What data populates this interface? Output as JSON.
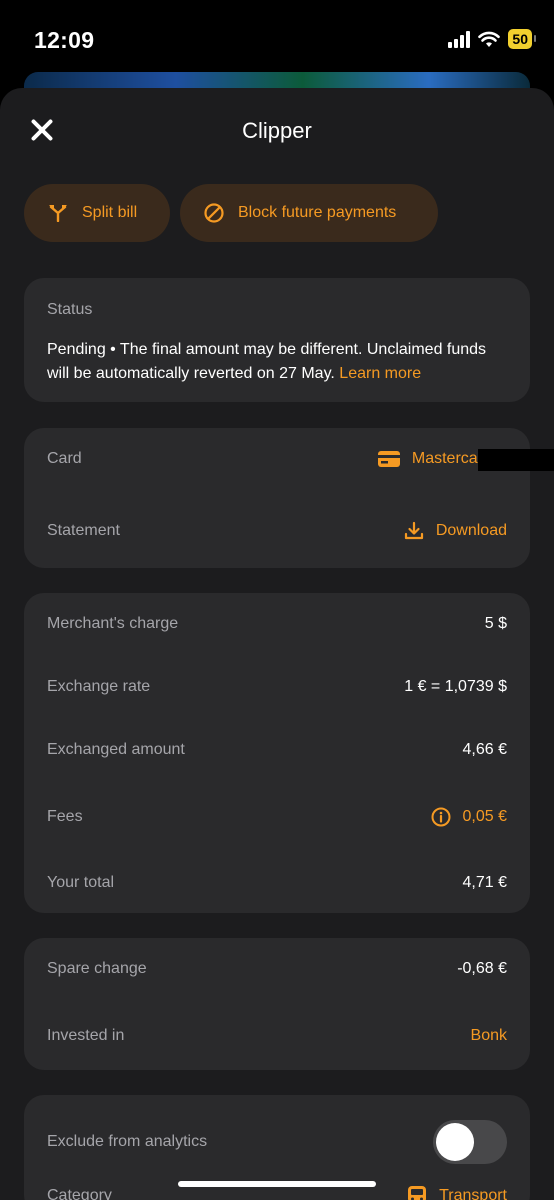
{
  "status_bar": {
    "time": "12:09",
    "battery": "50"
  },
  "header": {
    "title": "Clipper"
  },
  "actions": {
    "split_label": "Split bill",
    "block_label": "Block future payments"
  },
  "status": {
    "label": "Status",
    "text": "Pending • The final amount may be different. Unclaimed funds will be automatically reverted on 27 May.",
    "link": "Learn more"
  },
  "card_section": {
    "card_label": "Card",
    "card_value": "Mastercard ··",
    "statement_label": "Statement",
    "statement_value": "Download"
  },
  "charges": [
    {
      "label": "Merchant's charge",
      "value": "5 $"
    },
    {
      "label": "Exchange rate",
      "value": "1 € = 1,0739 $"
    },
    {
      "label": "Exchanged amount",
      "value": "4,66 €"
    },
    {
      "label": "Fees",
      "value": "0,05 €"
    },
    {
      "label": "Your total",
      "value": "4,71 €"
    }
  ],
  "spare": {
    "spare_label": "Spare change",
    "spare_value": "-0,68 €",
    "invested_label": "Invested in",
    "invested_value": "Bonk"
  },
  "analytics": {
    "exclude_label": "Exclude from analytics",
    "exclude_on": false,
    "category_label": "Category",
    "category_value": "Transport"
  },
  "colors": {
    "accent": "#f59a23",
    "sheet": "#1c1c1e",
    "card": "#2a2a2c"
  }
}
